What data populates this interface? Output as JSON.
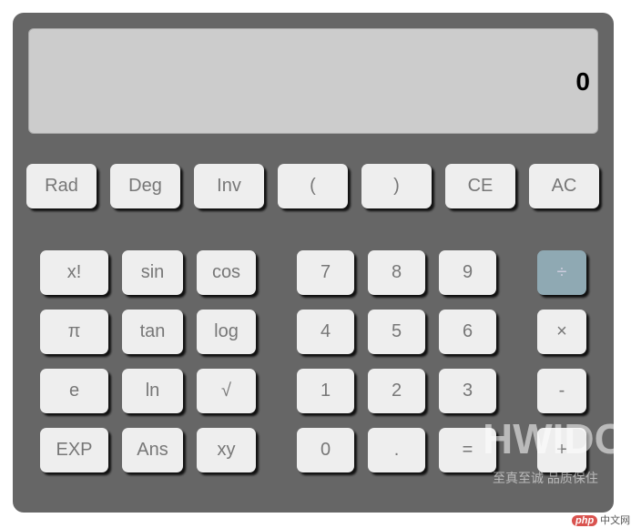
{
  "display": {
    "value": "0"
  },
  "top_row": [
    "Rad",
    "Deg",
    "Inv",
    "(",
    ")",
    "CE",
    "AC"
  ],
  "grid": [
    [
      "x!",
      "sin",
      "cos",
      "7",
      "8",
      "9",
      "÷"
    ],
    [
      "π",
      "tan",
      "log",
      "4",
      "5",
      "6",
      "×"
    ],
    [
      "e",
      "ln",
      "√",
      "1",
      "2",
      "3",
      "-"
    ],
    [
      "EXP",
      "Ans",
      "xy",
      "0",
      ".",
      "=",
      "+"
    ]
  ],
  "colors": {
    "body": "#666666",
    "display": "#cccccc",
    "button": "#eeeeee",
    "active_operator": "#8fa9b3"
  },
  "watermark": {
    "brand": "HWIDC",
    "slogan": "至真至诚 品质保住",
    "site_logo": "php",
    "site_text": "中文网"
  }
}
